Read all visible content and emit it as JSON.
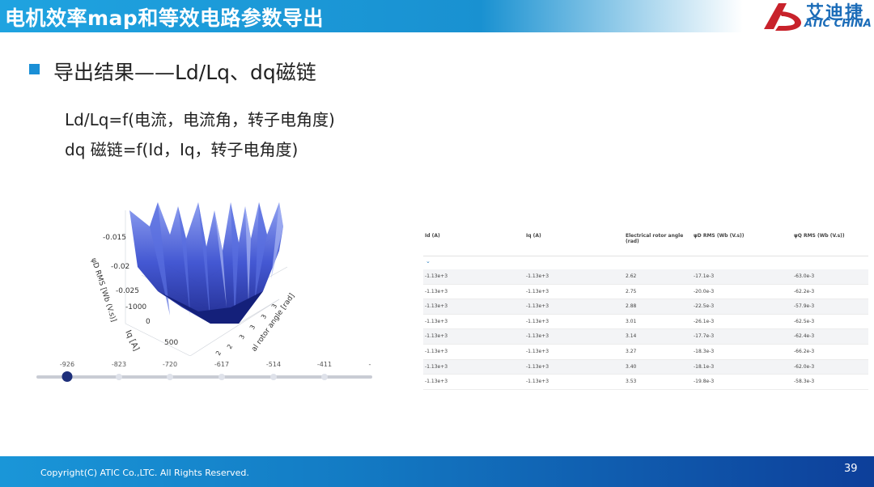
{
  "header": {
    "title": "电机效率map和等效电路参数导出",
    "logo_text": "艾迪捷",
    "logo_sub": "ATIC CHINA"
  },
  "section": {
    "heading": "导出结果——Ld/Lq、dq磁链",
    "line1": "Ld/Lq=f(电流，电流角，转子电角度)",
    "line2": "dq 磁链=f(Id，Iq，转子电角度)"
  },
  "plot": {
    "z_label": "ψD RMS [Wb (V.s)]",
    "z_ticks": [
      "-0.015",
      "-0.02",
      "-0.025"
    ],
    "y_label": "Iq [A]",
    "y_ticks": [
      "-1000",
      "0",
      "500"
    ],
    "x_label": "al rotor angle [rad]",
    "x_ticks": [
      "3",
      "3",
      "3",
      "3",
      "2",
      "2"
    ],
    "surface_color": "#2f46c8"
  },
  "slider": {
    "labels": [
      "-926",
      "-823",
      "-720",
      "-617",
      "-514",
      "-411",
      "-"
    ],
    "selected_index": 0
  },
  "table": {
    "headers": [
      "Id (A)",
      "Iq (A)",
      "Electrical rotor angle (rad)",
      "ψD RMS (Wb (V.s))",
      "ψQ RMS (Wb (V.s))"
    ],
    "rows": [
      [
        "-1.13e+3",
        "-1.13e+3",
        "2.62",
        "-17.1e-3",
        "-63.0e-3"
      ],
      [
        "-1.13e+3",
        "-1.13e+3",
        "2.75",
        "-20.0e-3",
        "-62.2e-3"
      ],
      [
        "-1.13e+3",
        "-1.13e+3",
        "2.88",
        "-22.5e-3",
        "-57.9e-3"
      ],
      [
        "-1.13e+3",
        "-1.13e+3",
        "3.01",
        "-26.1e-3",
        "-62.5e-3"
      ],
      [
        "-1.13e+3",
        "-1.13e+3",
        "3.14",
        "-17.7e-3",
        "-62.4e-3"
      ],
      [
        "-1.13e+3",
        "-1.13e+3",
        "3.27",
        "-18.3e-3",
        "-66.2e-3"
      ],
      [
        "-1.13e+3",
        "-1.13e+3",
        "3.40",
        "-18.1e-3",
        "-62.0e-3"
      ],
      [
        "-1.13e+3",
        "-1.13e+3",
        "3.53",
        "-19.8e-3",
        "-58.3e-3"
      ]
    ]
  },
  "footer": {
    "copyright": "Copyright(C) ATIC Co.,LTC. All Rights Reserved.",
    "page_number": "39"
  }
}
